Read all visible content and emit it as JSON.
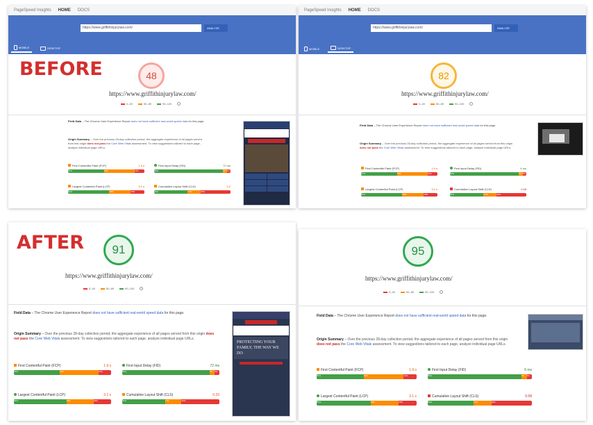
{
  "labels": {
    "before": "BEFORE",
    "after": "AFTER"
  },
  "psi": {
    "title": "PageSpeed Insights",
    "nav_home": "HOME",
    "nav_docs": "DOCS",
    "url_value": "https://www.griffithinjurylaw.com/",
    "analyze_label": "ANALYZE",
    "tab_mobile": "MOBILE",
    "tab_desktop": "DESKTOP"
  },
  "site_url": "https://www.griffithinjurylaw.com/",
  "legend": {
    "red": "0–49",
    "orange": "50–89",
    "green": "90–100"
  },
  "field": {
    "title": "Field Data",
    "text": "– The Chrome User Experience Report",
    "link": "does not have sufficient real-world speed data",
    "suffix": "for this page."
  },
  "origin": {
    "title": "Origin Summary",
    "text": "– Over the previous 28-day collection period, the aggregate experience of all pages served from this origin",
    "fail": "does not pass",
    "mid": "the",
    "link": "Core Web Vitals",
    "tail": "assessment. To view suggestions tailored to each page, analyze individual page URLs."
  },
  "metric_names": {
    "fcp": "First Contentful Paint (FCP)",
    "fid": "First Input Delay (FID)",
    "lcp": "Largest Contentful Paint (LCP)",
    "cls": "Cumulative Layout Shift (CLS)"
  },
  "before_mobile": {
    "score": "48",
    "metrics": {
      "fcp": "1.9 s",
      "fid": "72 ms",
      "lcp": "3.1 s",
      "cls": "0.2"
    }
  },
  "before_desktop": {
    "score": "82",
    "metrics": {
      "fcp": "1.9 s",
      "fid": "6 ms",
      "lcp": "3.1 s",
      "cls": "0.58"
    }
  },
  "after_mobile": {
    "score": "91",
    "metrics": {
      "fcp": "1.9 s",
      "fid": "72 ms",
      "lcp": "3.1 s",
      "cls": "0.33"
    },
    "hero_text": "PROTECTING YOUR FAMILY, THE WAY WE DO"
  },
  "after_desktop": {
    "score": "95",
    "metrics": {
      "fcp": "1.9 s",
      "fid": "6 ms",
      "lcp": "3.1 s",
      "cls": "0.58"
    }
  },
  "bars": {
    "fcp": [
      "47%",
      "40%",
      "13%"
    ],
    "fid": [
      "90%",
      "5%",
      "5%"
    ],
    "lcp": [
      "54%",
      "28%",
      "18%"
    ],
    "cls": [
      "44%",
      "17%",
      "39%"
    ]
  },
  "colors": {
    "accent_blue": "#4a72c4",
    "red": "#d32f2f",
    "orange": "#fb8c00",
    "green": "#43a047"
  }
}
